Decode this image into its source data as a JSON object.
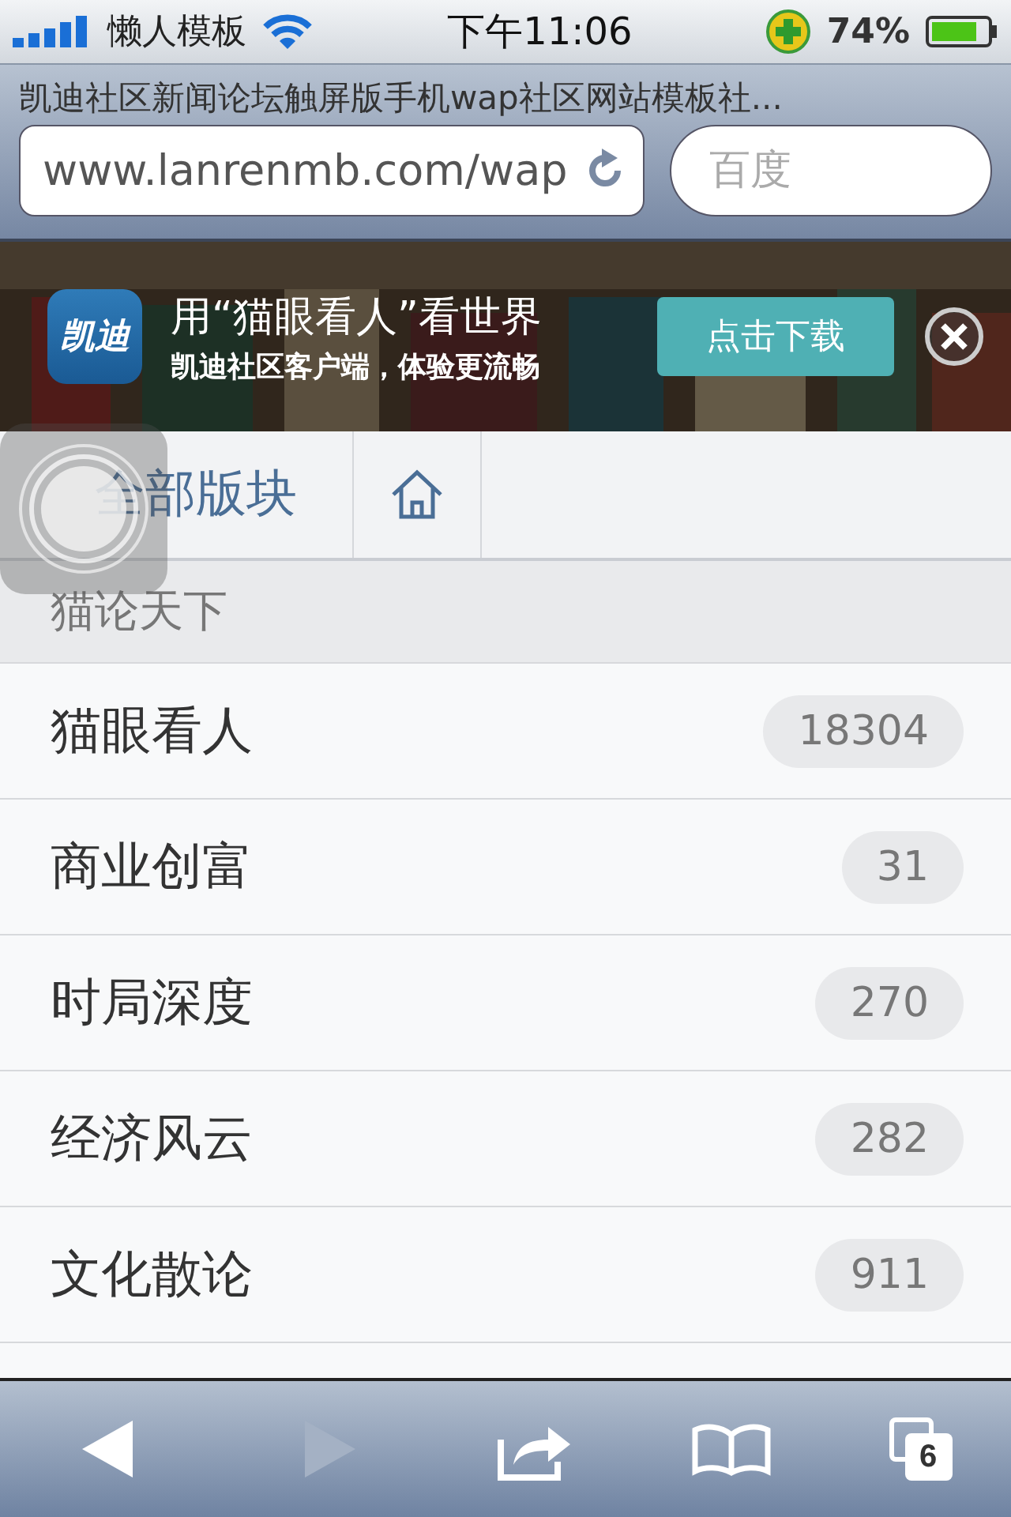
{
  "status_bar": {
    "carrier": "懒人模板",
    "time": "下午11:06",
    "battery": "74%"
  },
  "browser": {
    "title": "凯迪社区新闻论坛触屏版手机wap社区网站模板社...",
    "url": "www.lanrenmb.com/wap",
    "search": {
      "placeholder": "百度"
    }
  },
  "banner": {
    "headline": "用“猫眼看人”看世界",
    "subline": "凯迪社区客户端，体验更流畅",
    "button": "点击下载",
    "logo": "凯迪"
  },
  "nav": {
    "title": "全部版块"
  },
  "section": {
    "title": "猫论天下"
  },
  "forums": [
    {
      "name": "猫眼看人",
      "count": "18304"
    },
    {
      "name": "商业创富",
      "count": "31"
    },
    {
      "name": "时局深度",
      "count": "270"
    },
    {
      "name": "经济风云",
      "count": "282"
    },
    {
      "name": "文化散论",
      "count": "911"
    }
  ],
  "toolbar": {
    "back_disabled": false,
    "forward_disabled": true,
    "tabs_count": "6"
  }
}
